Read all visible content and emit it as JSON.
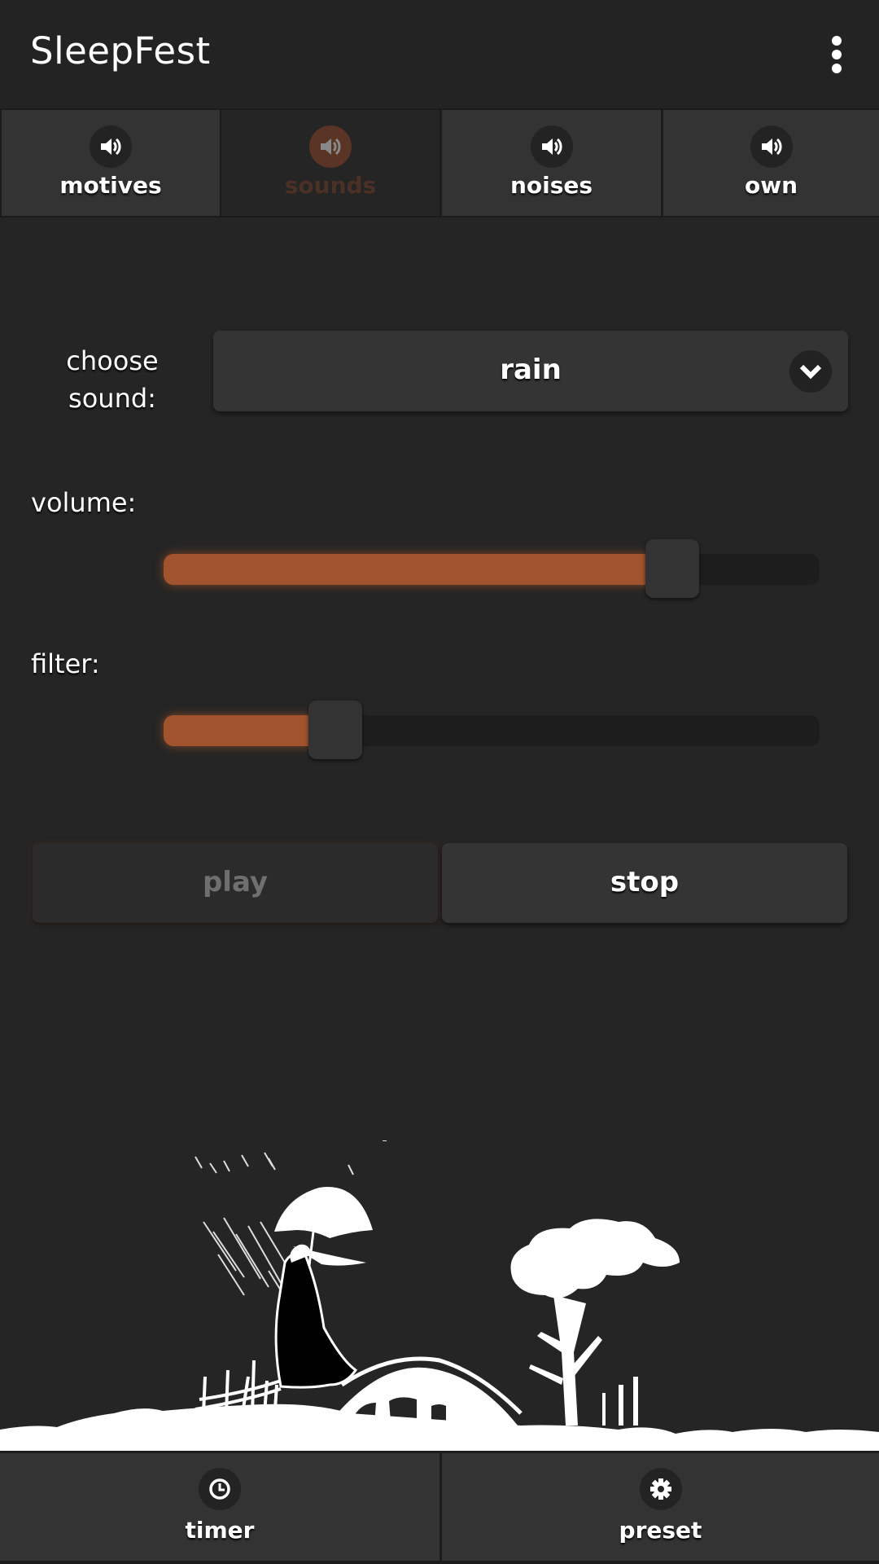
{
  "header": {
    "title": "SleepFest",
    "menu_icon": "more-vert-icon"
  },
  "tabs": [
    {
      "label": "motives",
      "icon": "speaker-icon",
      "active": false
    },
    {
      "label": "sounds",
      "icon": "speaker-icon",
      "active": true
    },
    {
      "label": "noises",
      "icon": "speaker-icon",
      "active": false
    },
    {
      "label": "own",
      "icon": "speaker-icon",
      "active": false
    }
  ],
  "sound_select": {
    "label_line1": "choose",
    "label_line2": "sound:",
    "selected_value": "rain",
    "icon": "chevron-down-icon"
  },
  "volume": {
    "label": "volume:",
    "value_fraction": 0.8
  },
  "filter": {
    "label": "filter:",
    "value_fraction": 0.24
  },
  "controls": {
    "play_label": "play",
    "play_enabled": false,
    "stop_label": "stop"
  },
  "illustration": {
    "subject": "girl-with-umbrella-in-rain-over-bridge-and-tree"
  },
  "footer": {
    "timer_label": "timer",
    "timer_icon": "clock-icon",
    "preset_label": "preset",
    "preset_icon": "gear-icon"
  },
  "colors": {
    "background": "#252525",
    "accent": "#a0532d",
    "panel": "#333333",
    "track": "#1d1d1d"
  }
}
